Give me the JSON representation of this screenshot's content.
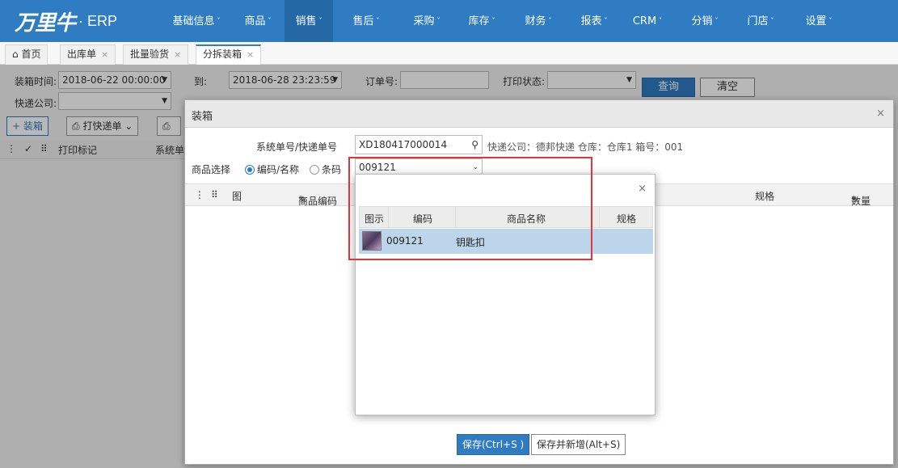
{
  "nav": {
    "brand": "万里牛",
    "product": "· ERP",
    "items": [
      "基础信息",
      "商品",
      "销售",
      "售后",
      "采购",
      "库存",
      "财务",
      "报表",
      "CRM",
      "分销",
      "门店",
      "设置"
    ],
    "active": "销售",
    "caret": "˅"
  },
  "tabs": [
    {
      "label": "首页",
      "closable": false
    },
    {
      "label": "出库单",
      "closable": true
    },
    {
      "label": "批量验货",
      "closable": true
    },
    {
      "label": "分拆装箱",
      "closable": true,
      "active": true
    }
  ],
  "tab_close": "×",
  "home_icon": "⌂",
  "filters": {
    "pack_time_label": "装箱时间:",
    "pack_time_from": "2018-06-22 00:00:00",
    "to_label": "到:",
    "pack_time_to": "2018-06-28 23:23:59",
    "order_no_label": "订单号:",
    "print_status_label": "打印状态:",
    "courier_label": "快递公司:",
    "query_button": "查询",
    "clear_button": "清空"
  },
  "toolbar": {
    "pack_button": "+ 装箱",
    "print_button": "打快递单",
    "caret": "⌄"
  },
  "bg_grid": {
    "print_mark": "打印标记",
    "system": "系统单"
  },
  "modal": {
    "title": "装箱",
    "close": "×",
    "order_label": "系统单号/快递单号",
    "order_value": "XD180417000014",
    "info": "快递公司：德邦快递   仓库：仓库1   箱号：001",
    "goods_select_label": "商品选择",
    "radio_code_name": "编码/名称",
    "radio_barcode": "条码",
    "goods_input": "009121",
    "columns": {
      "image": "图",
      "code": "商品编码",
      "spec": "规格",
      "qty": "数量"
    },
    "save_button": "保存(Ctrl+S )",
    "save_new_button": "保存并新增(Alt+S)"
  },
  "popup": {
    "close": "×",
    "columns": [
      "图示",
      "编码",
      "商品名称",
      "规格"
    ],
    "rows": [
      {
        "code": "009121",
        "name": "钥匙扣",
        "spec": ""
      }
    ]
  },
  "colors": {
    "nav": "#2f7cc2",
    "highlight": "#e0353a",
    "selected_row": "#bcd5ea"
  }
}
